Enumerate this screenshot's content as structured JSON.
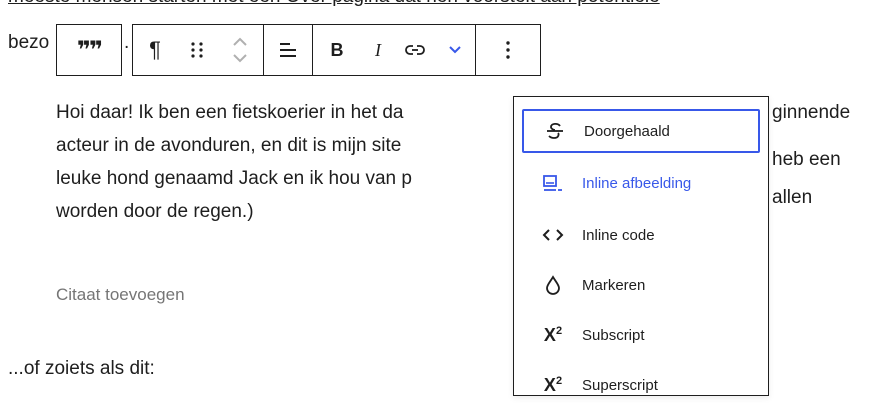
{
  "editor": {
    "top_line": "meeste mensen starten met een Over pagina dat hen voorstelt aan potentiele",
    "bezo": "bezo",
    "dot": ".",
    "paragraph_lines": [
      "Hoi daar! Ik ben een fietskoerier in het da",
      "acteur in de avonduren, en dit is mijn site",
      "leuke hond genaamd Jack en ik hou van p",
      "worden door de regen.)"
    ],
    "paragraph_right": [
      "ginnende",
      "heb een",
      "allen"
    ],
    "citation_placeholder": "Citaat toevoegen",
    "after_text": "...of zoiets als dit:"
  },
  "toolbar": {
    "quote_icon": "quote-icon",
    "paragraph_icon": "pilcrow-icon",
    "drag_icon": "drag-handle-icon",
    "move_icon": "move-up-down-icon",
    "align_icon": "align-icon",
    "bold_label": "B",
    "italic_label": "I",
    "link_icon": "link-icon",
    "more_rich_icon": "chevron-down-icon",
    "options_icon": "more-vertical-icon",
    "accent": "#3858e9"
  },
  "dropdown": {
    "items": [
      {
        "label": "Doorgehaald",
        "icon": "strikethrough-icon",
        "state": "focused"
      },
      {
        "label": "Inline afbeelding",
        "icon": "inline-image-icon",
        "state": "active"
      },
      {
        "label": "Inline code",
        "icon": "code-icon",
        "state": ""
      },
      {
        "label": "Markeren",
        "icon": "highlight-drop-icon",
        "state": ""
      },
      {
        "label": "Subscript",
        "icon": "subscript-icon",
        "state": ""
      },
      {
        "label": "Superscript",
        "icon": "superscript-icon",
        "state": ""
      }
    ]
  }
}
